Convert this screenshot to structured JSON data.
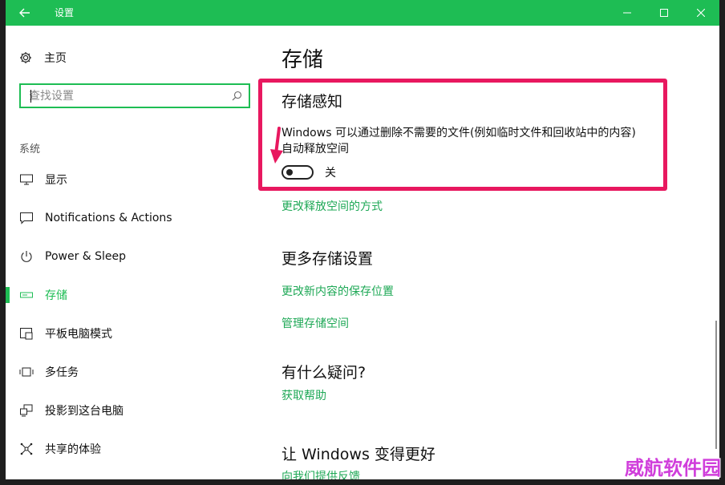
{
  "window": {
    "title": "设置"
  },
  "sidebar": {
    "home_label": "主页",
    "search_placeholder": "查找设置",
    "section_label": "系统",
    "items": [
      {
        "label": "显示",
        "icon": "monitor-icon"
      },
      {
        "label": "Notifications & Actions",
        "icon": "notification-icon"
      },
      {
        "label": "Power & Sleep",
        "icon": "power-icon"
      },
      {
        "label": "存储",
        "icon": "storage-icon",
        "active": true
      },
      {
        "label": "平板电脑模式",
        "icon": "tablet-mode-icon"
      },
      {
        "label": "多任务",
        "icon": "multitasking-icon"
      },
      {
        "label": "投影到这台电脑",
        "icon": "project-icon"
      },
      {
        "label": "共享的体验",
        "icon": "shared-experience-icon"
      }
    ]
  },
  "main": {
    "title": "存储",
    "storage_sense": {
      "heading": "存储感知",
      "description": "Windows 可以通过删除不需要的文件(例如临时文件和回收站中的内容)自动释放空间",
      "toggle_state": "关",
      "toggle_on": false,
      "link": "更改释放空间的方式"
    },
    "more_settings": {
      "heading": "更多存储设置",
      "links": [
        "更改新内容的保存位置",
        "管理存储空间"
      ]
    },
    "questions": {
      "heading": "有什么疑问?",
      "link": "获取帮助"
    },
    "improve": {
      "heading": "让 Windows 变得更好",
      "link": "向我们提供反馈"
    }
  },
  "watermark": "威航软件园",
  "colors": {
    "accent": "#1ebd54",
    "link": "#1ea856",
    "highlight": "#e8185f"
  }
}
